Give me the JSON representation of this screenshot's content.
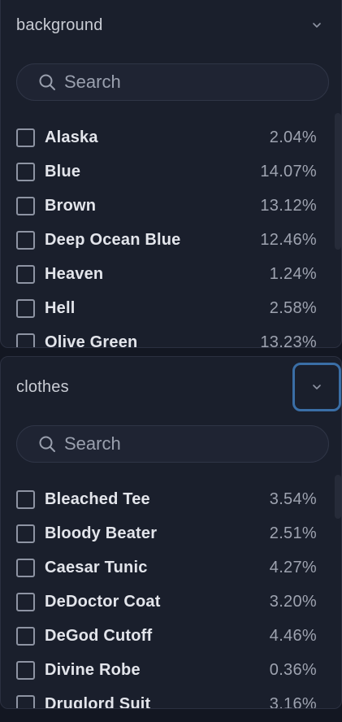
{
  "filters": [
    {
      "title": "background",
      "search_placeholder": "Search",
      "options": [
        {
          "label": "Alaska",
          "percent": "2.04%"
        },
        {
          "label": "Blue",
          "percent": "14.07%"
        },
        {
          "label": "Brown",
          "percent": "13.12%"
        },
        {
          "label": "Deep Ocean Blue",
          "percent": "12.46%"
        },
        {
          "label": "Heaven",
          "percent": "1.24%"
        },
        {
          "label": "Hell",
          "percent": "2.58%"
        },
        {
          "label": "Olive Green",
          "percent": "13.23%"
        }
      ]
    },
    {
      "title": "clothes",
      "search_placeholder": "Search",
      "options": [
        {
          "label": "Bleached Tee",
          "percent": "3.54%"
        },
        {
          "label": "Bloody Beater",
          "percent": "2.51%"
        },
        {
          "label": "Caesar Tunic",
          "percent": "4.27%"
        },
        {
          "label": "DeDoctor Coat",
          "percent": "3.20%"
        },
        {
          "label": "DeGod Cutoff",
          "percent": "4.46%"
        },
        {
          "label": "Divine Robe",
          "percent": "0.36%"
        },
        {
          "label": "Druglord Suit",
          "percent": "3.16%"
        }
      ]
    }
  ],
  "icons": {
    "search": "search-icon",
    "collapse": "chevron-down-icon"
  },
  "colors": {
    "background": "#131722",
    "panel": "#1a1f2c",
    "focus_ring": "#3a6ea6"
  }
}
